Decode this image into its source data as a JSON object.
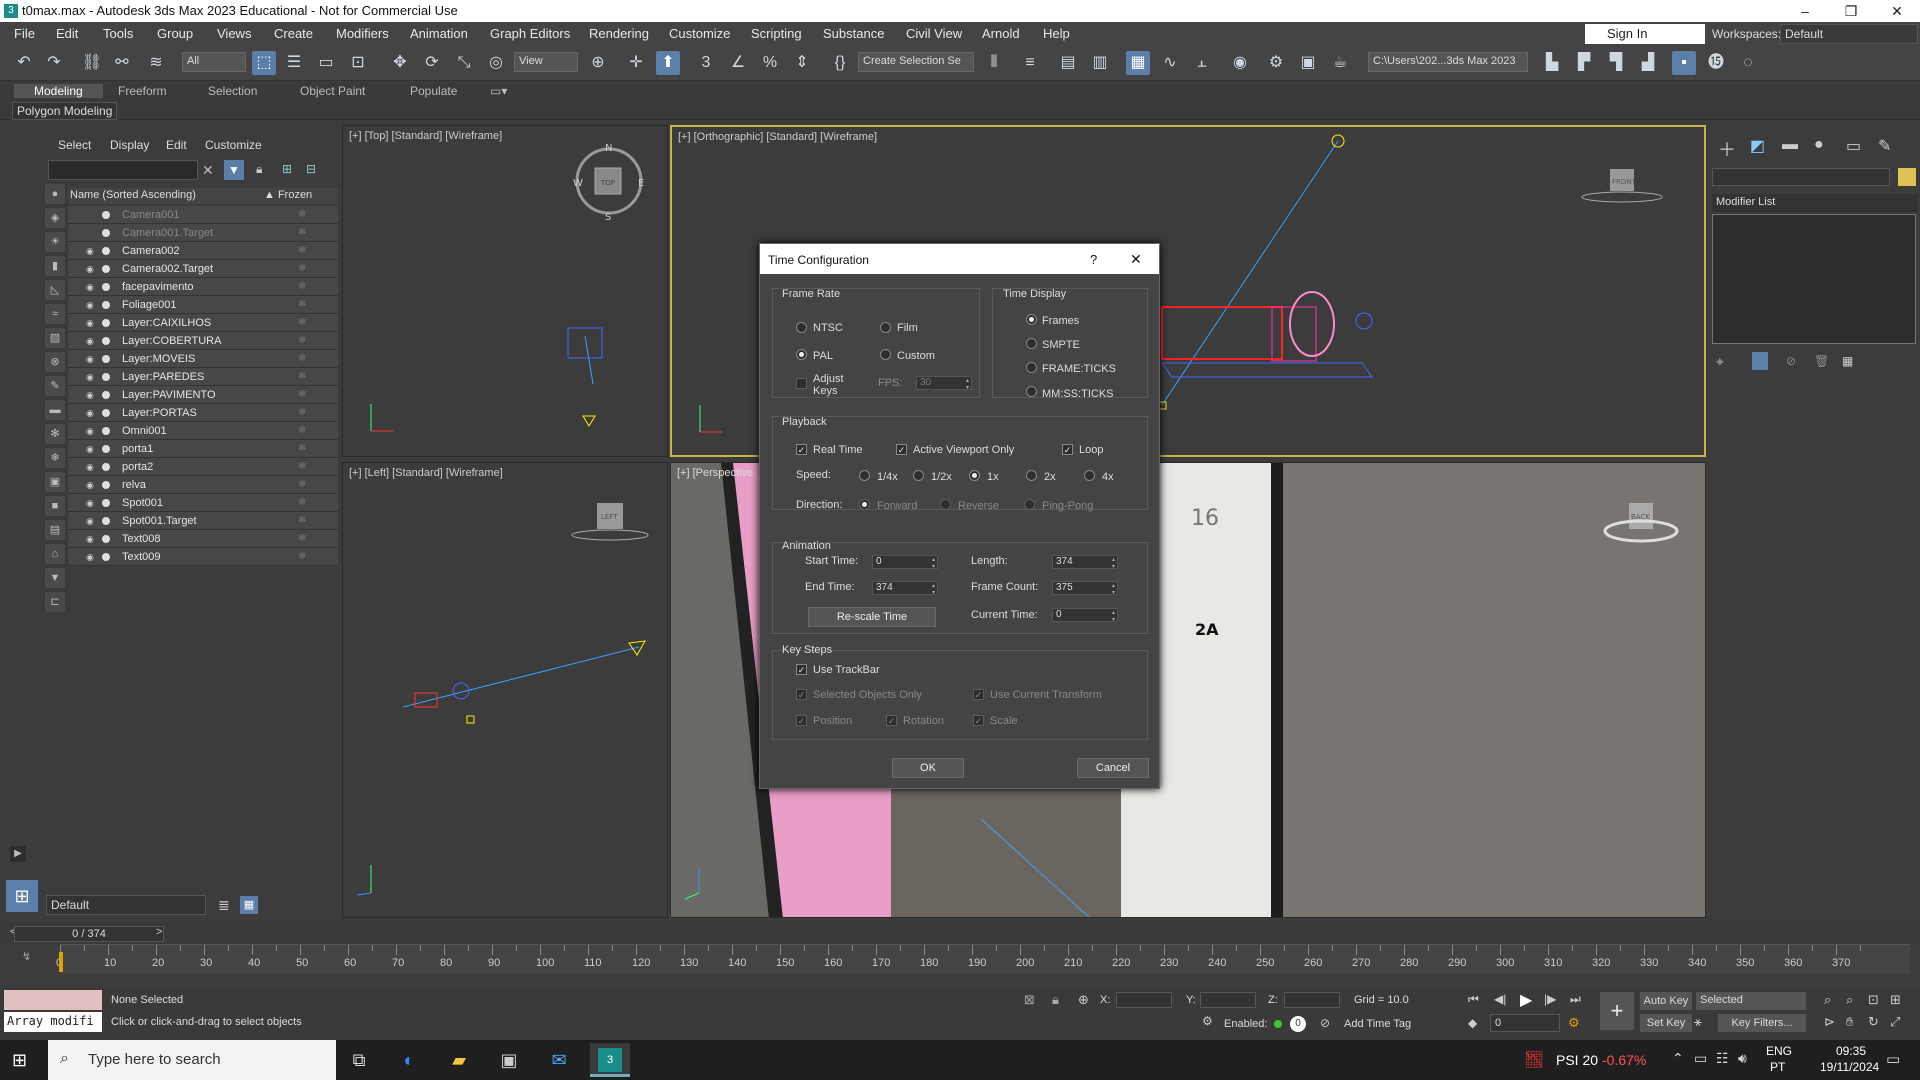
{
  "window": {
    "title": "t0max.max - Autodesk 3ds Max 2023 Educational - Not for Commercial Use"
  },
  "menu": [
    "File",
    "Edit",
    "Tools",
    "Group",
    "Views",
    "Create",
    "Modifiers",
    "Animation",
    "Graph Editors",
    "Rendering",
    "Customize",
    "Scripting",
    "Substance",
    "Civil View",
    "Arnold",
    "Help"
  ],
  "account": {
    "signin": "Sign In",
    "workspaces_label": "Workspaces:",
    "workspace": "Default"
  },
  "toolbar": {
    "filter": "All",
    "refcoord": "View",
    "selset": "Create Selection Se",
    "path": "C:\\Users\\202...3ds Max 2023"
  },
  "ribbon": {
    "tabs": [
      "Modeling",
      "Freeform",
      "Selection",
      "Object Paint",
      "Populate"
    ],
    "sub": "Polygon Modeling"
  },
  "scene_explorer": {
    "tabs": [
      "Select",
      "Display",
      "Edit",
      "Customize"
    ],
    "col_name": "Name (Sorted Ascending)",
    "col_frozen": "▲ Frozen",
    "items": [
      "Camera001",
      "Camera001.Target",
      "Camera002",
      "Camera002.Target",
      "facepavimento",
      "Foliage001",
      "Layer:CAIXILHOS",
      "Layer:COBERTURA",
      "Layer:MOVEIS",
      "Layer:PAREDES",
      "Layer:PAVIMENTO",
      "Layer:PORTAS",
      "Omni001",
      "porta1",
      "porta2",
      "relva",
      "Spot001",
      "Spot001.Target",
      "Text008",
      "Text009"
    ],
    "layer": "Default"
  },
  "viewports": {
    "top": "[+] [Top] [Standard] [Wireframe]",
    "ortho": "[+] [Orthographic] [Standard] [Wireframe]",
    "left": "[+] [Left] [Standard] [Wireframe]",
    "persp": "[+] [Perspective",
    "cube_top": "TOP",
    "cube_front": "FRONT",
    "cube_left": "LEFT",
    "cube_back": "BACK",
    "compass": [
      "N",
      "E",
      "S",
      "W"
    ],
    "door_number": "16",
    "door_label": "2A"
  },
  "command_panel": {
    "modifier_list": "Modifier List"
  },
  "dialog": {
    "title": "Time Configuration",
    "help": "?",
    "close": "✕",
    "frame_rate": {
      "label": "Frame Rate",
      "ntsc": "NTSC",
      "film": "Film",
      "pal": "PAL",
      "custom": "Custom",
      "adjust_keys": "Adjust Keys",
      "fps_label": "FPS:",
      "fps": "30"
    },
    "time_display": {
      "label": "Time Display",
      "frames": "Frames",
      "smpte": "SMPTE",
      "frameticks": "FRAME:TICKS",
      "mmssticks": "MM:SS:TICKS"
    },
    "playback": {
      "label": "Playback",
      "real_time": "Real Time",
      "active_vp": "Active Viewport Only",
      "loop": "Loop",
      "speed_label": "Speed:",
      "speeds": [
        "1/4x",
        "1/2x",
        "1x",
        "2x",
        "4x"
      ],
      "direction_label": "Direction:",
      "dirs": [
        "Forward",
        "Reverse",
        "Ping-Pong"
      ]
    },
    "animation": {
      "label": "Animation",
      "start_label": "Start Time:",
      "start": "0",
      "end_label": "End Time:",
      "end": "374",
      "length_label": "Length:",
      "length": "374",
      "fc_label": "Frame Count:",
      "fc": "375",
      "cur_label": "Current Time:",
      "cur": "0",
      "rescale": "Re-scale Time"
    },
    "key_steps": {
      "label": "Key Steps",
      "use_trackbar": "Use TrackBar",
      "sel_only": "Selected Objects Only",
      "use_cur": "Use Current Transform",
      "position": "Position",
      "rotation": "Rotation",
      "scale": "Scale"
    },
    "ok": "OK",
    "cancel": "Cancel"
  },
  "timeline": {
    "slider": "0 / 374",
    "ticks": [
      "0",
      "10",
      "20",
      "30",
      "40",
      "50",
      "60",
      "70",
      "80",
      "90",
      "100",
      "110",
      "120",
      "130",
      "140",
      "150",
      "160",
      "170",
      "180",
      "190",
      "200",
      "210",
      "220",
      "230",
      "240",
      "250",
      "260",
      "270",
      "280",
      "290",
      "300",
      "310",
      "320",
      "330",
      "340",
      "350",
      "360",
      "370"
    ]
  },
  "status": {
    "maxscript": "Array modifi",
    "none": "None Selected",
    "prompt": "Click or click-and-drag to select objects",
    "x": "X:",
    "y": "Y:",
    "z": "Z:",
    "grid": "Grid = 10.0",
    "enabled": "Enabled:",
    "addtag": "Add Time Tag",
    "autokey": "Auto Key",
    "selected": "Selected",
    "setkey": "Set Key",
    "keyfilters": "Key Filters...",
    "frame": "0"
  },
  "taskbar": {
    "search": "Type here to search",
    "stock": "PSI 20",
    "stock_chg": "-0.67%",
    "lang1": "ENG",
    "lang2": "PT",
    "time": "09:35",
    "date": "19/11/2024"
  }
}
